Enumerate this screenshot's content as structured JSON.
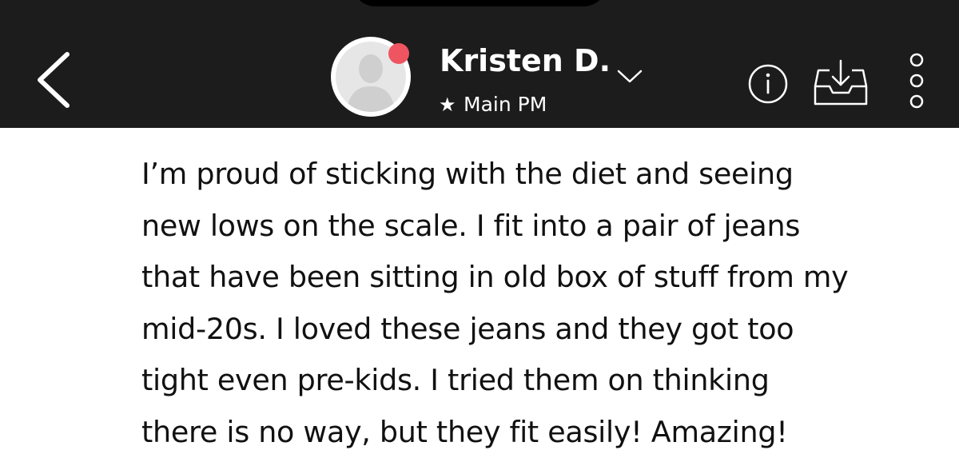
{
  "header": {
    "back_icon": "chevron-left-icon",
    "contact_name": "Kristen D.",
    "name_dropdown_icon": "chevron-down-icon",
    "subtitle_icon": "star-icon",
    "subtitle_star": "★",
    "subtitle": "Main PM",
    "info_icon": "info-icon",
    "download_icon": "download-tray-icon",
    "more_icon": "more-vertical-icon",
    "status_color": "#ee5560",
    "background_color": "#1c1c1c"
  },
  "message": {
    "lines": [
      "I’m proud of sticking with the diet and seeing",
      "new lows on the scale. I fit into a pair of jeans",
      "that have been sitting in old box of stuff from my",
      "mid-20s. I loved these jeans and they got too",
      "tight even pre-kids. I tried them on thinking",
      "there is no way, but they fit easily!  Amazing!"
    ]
  }
}
